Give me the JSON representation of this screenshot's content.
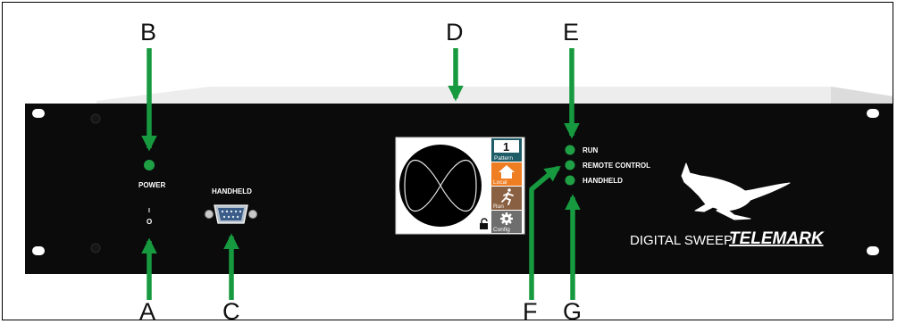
{
  "callouts": {
    "a": "A",
    "b": "B",
    "c": "C",
    "d": "D",
    "e": "E",
    "f": "F",
    "g": "G"
  },
  "panel": {
    "power_label": "POWER",
    "switch_marks": {
      "on": "I",
      "off": "O"
    },
    "handheld_port_label": "HANDHELD",
    "indicators": [
      {
        "label": "RUN"
      },
      {
        "label": "REMOTE CONTROL"
      },
      {
        "label": "HANDHELD"
      }
    ],
    "product_name": "DIGITAL SWEEP",
    "brand": "TELEMARK"
  },
  "display": {
    "pattern_number": "1",
    "pattern_label": "Pattern",
    "local_label": "Local",
    "run_label": "Run",
    "config_label": "Config"
  },
  "colors": {
    "panel": "#0b0b0b",
    "arrow_green": "#179a3f",
    "led_green": "#1fa045",
    "orange_button": "#ef7d22",
    "brown_button": "#8a6042",
    "gray_button": "#6e6e6e",
    "pattern_teal": "#1e5c68"
  }
}
